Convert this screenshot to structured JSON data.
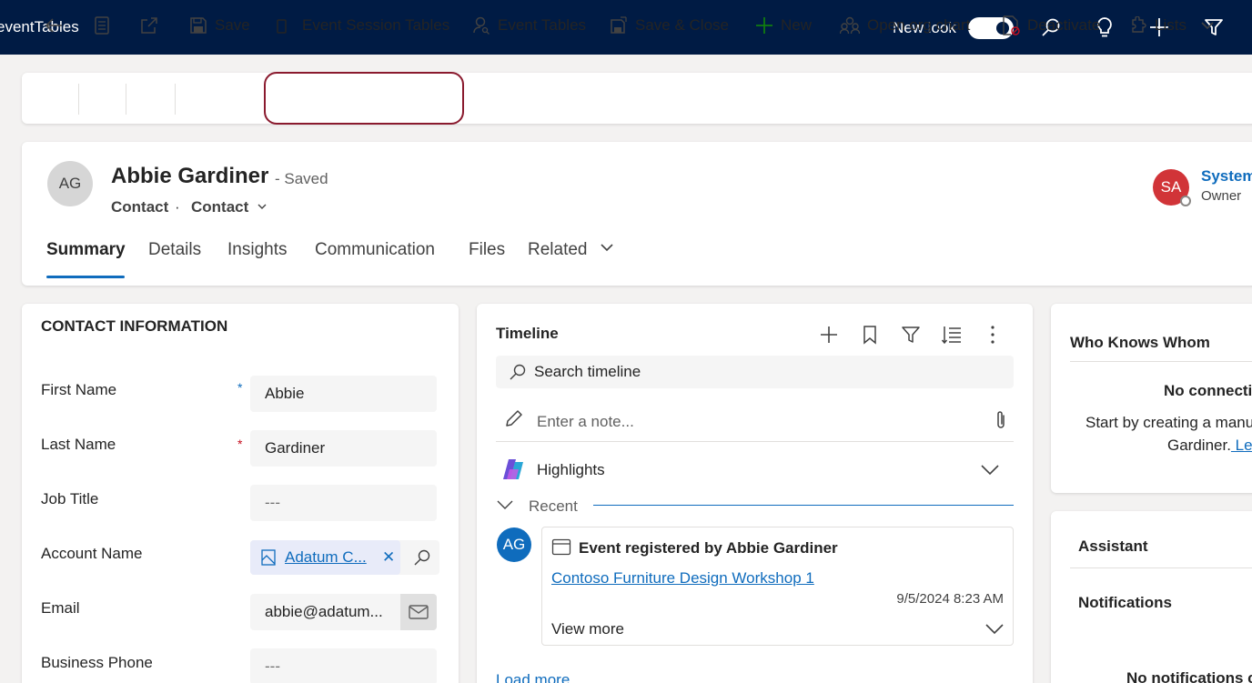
{
  "topbar": {
    "app_title": "eventTables",
    "new_look_label": "New look",
    "new_look_on": true,
    "icons": [
      "search-icon",
      "lightbulb-icon",
      "plus-icon",
      "filter-icon"
    ]
  },
  "commandbar": {
    "save": "Save",
    "event_session_tables": "Event Session Tables",
    "event_tables": "Event Tables",
    "save_close": "Save & Close",
    "new": "New",
    "org_chart": "Open org chart",
    "deactivate": "Deactivate",
    "lists": "Lists"
  },
  "record": {
    "initials": "AG",
    "name": "Abbie Gardiner",
    "status": "- Saved",
    "entity": "Contact",
    "separator": "·",
    "form": "Contact",
    "owner_initials": "SA",
    "owner_name": "System",
    "owner_role": "Owner"
  },
  "tabs": [
    "Summary",
    "Details",
    "Insights",
    "Communication",
    "Files",
    "Related"
  ],
  "contact_info": {
    "title": "CONTACT INFORMATION",
    "fields": {
      "first_name": {
        "label": "First Name",
        "value": "Abbie",
        "required_mark": "*"
      },
      "last_name": {
        "label": "Last Name",
        "value": "Gardiner",
        "required_mark": "*"
      },
      "job_title": {
        "label": "Job Title",
        "value": "---"
      },
      "account_name": {
        "label": "Account Name",
        "value": "Adatum C...",
        "clear": "✕"
      },
      "email": {
        "label": "Email",
        "value": "abbie@adatum..."
      },
      "business_phone": {
        "label": "Business Phone",
        "value": "---"
      }
    }
  },
  "timeline": {
    "title": "Timeline",
    "search_label": "Search timeline",
    "note_placeholder": "Enter a note...",
    "highlights": "Highlights",
    "recent": "Recent",
    "item": {
      "avatar": "AG",
      "title": "Event registered by Abbie Gardiner",
      "link": "Contoso Furniture Design Workshop 1",
      "date": "9/5/2024 8:23 AM",
      "view_more": "View more"
    },
    "load_more": "Load more"
  },
  "who_knows_whom": {
    "title": "Who Knows Whom",
    "none": "No connecti",
    "desc1": "Start by creating a manu",
    "desc2": "Gardiner.",
    "learn": " Le"
  },
  "assistant": {
    "title": "Assistant",
    "notifications_title": "Notifications",
    "none": "No notifications c"
  },
  "colors": {
    "topbar": "#001b44",
    "accent": "#0f6cbd",
    "highlight_ring": "#8a1a2e",
    "owner_avatar": "#d13438"
  }
}
